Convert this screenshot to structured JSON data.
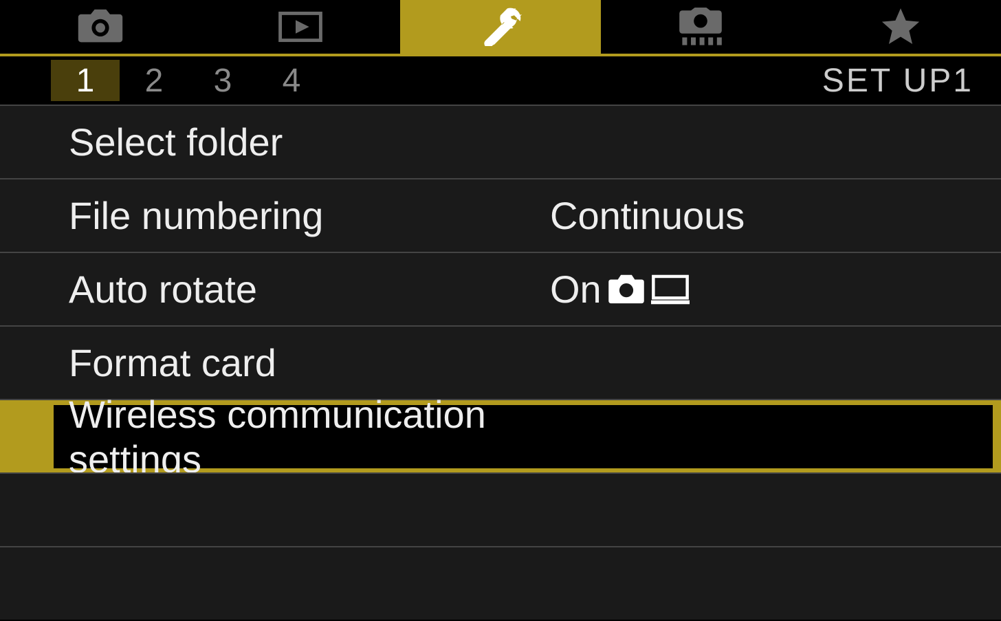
{
  "tabs": {
    "items": [
      "camera",
      "playback",
      "setup",
      "custom",
      "favorite"
    ],
    "activeIndex": 2
  },
  "pages": {
    "items": [
      "1",
      "2",
      "3",
      "4"
    ],
    "activeIndex": 0,
    "title": "SET  UP1"
  },
  "menu": {
    "rows": [
      {
        "label": "Select folder",
        "value": "",
        "icons": [],
        "selected": false
      },
      {
        "label": "File numbering",
        "value": "Continuous",
        "icons": [],
        "selected": false
      },
      {
        "label": "Auto rotate",
        "value": "On",
        "icons": [
          "camera",
          "computer"
        ],
        "selected": false
      },
      {
        "label": "Format card",
        "value": "",
        "icons": [],
        "selected": false
      },
      {
        "label": "Wireless communication settings",
        "value": "",
        "icons": [],
        "selected": true
      },
      {
        "label": "",
        "value": "",
        "icons": [],
        "selected": false,
        "empty": true
      },
      {
        "label": "",
        "value": "",
        "icons": [],
        "selected": false,
        "empty": true
      }
    ]
  },
  "colors": {
    "accent": "#b29b1e",
    "rowBg": "#1a1a1a"
  }
}
